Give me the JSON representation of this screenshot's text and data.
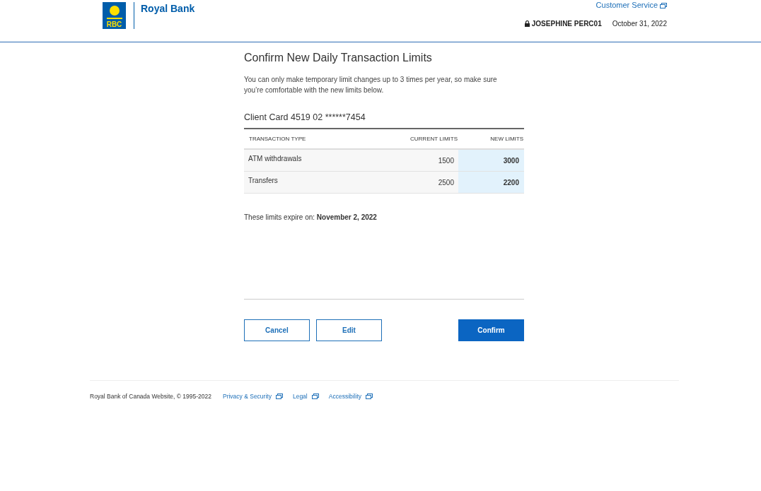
{
  "header": {
    "logo_mark": "RBC",
    "brand": "Royal Bank",
    "customer_service": "Customer Service",
    "user": "JOSEPHINE PERC01",
    "date": "October 31, 2022"
  },
  "title": "Confirm New Daily Transaction Limits",
  "intro": "You can only make temporary limit changes up to 3 times per year, so make sure you’re comfortable with the new limits below.",
  "card_title": "Client Card 4519 02 ******7454",
  "table": {
    "columns": [
      "TRANSACTION TYPE",
      "CURRENT LIMITS",
      "NEW LIMITS"
    ],
    "rows": [
      {
        "type": "ATM withdrawals",
        "current": "1500",
        "new": "3000"
      },
      {
        "type": "Transfers",
        "current": "2500",
        "new": "2200"
      }
    ]
  },
  "expiry": "These limits expire on: **November 2, 2022**",
  "buttons": [
    {
      "label": "Cancel",
      "kind": "secondary"
    },
    {
      "label": "Edit",
      "kind": "secondary"
    },
    {
      "label": "Confirm",
      "kind": "primary"
    }
  ],
  "footer": {
    "copyright": "Royal Bank of Canada Website, © 1995-2022",
    "links": [
      "Privacy & Security",
      "Legal",
      "Accessibility"
    ]
  }
}
